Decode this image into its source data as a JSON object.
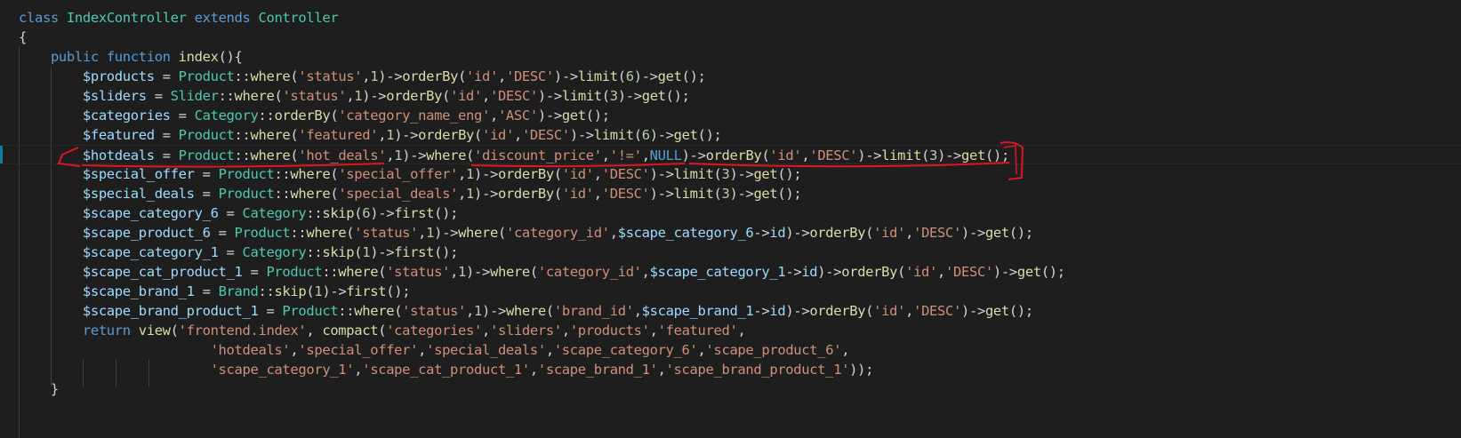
{
  "code": {
    "lines": [
      [
        [
          "kw",
          "class "
        ],
        [
          "cls",
          "IndexController "
        ],
        [
          "kw",
          "extends "
        ],
        [
          "cls",
          "Controller"
        ]
      ],
      [
        [
          "plain",
          "{"
        ]
      ],
      [
        [
          "plain",
          "    "
        ],
        [
          "kw",
          "public "
        ],
        [
          "kw",
          "function "
        ],
        [
          "fn",
          "index"
        ],
        [
          "plain",
          "(){"
        ]
      ],
      [
        [
          "plain",
          "        "
        ],
        [
          "var",
          "$products"
        ],
        [
          "plain",
          " = "
        ],
        [
          "cls",
          "Product"
        ],
        [
          "plain",
          "::"
        ],
        [
          "fn",
          "where"
        ],
        [
          "plain",
          "("
        ],
        [
          "str",
          "'status'"
        ],
        [
          "plain",
          ","
        ],
        [
          "num",
          "1"
        ],
        [
          "plain",
          ")->"
        ],
        [
          "fn",
          "orderBy"
        ],
        [
          "plain",
          "("
        ],
        [
          "str",
          "'id'"
        ],
        [
          "plain",
          ","
        ],
        [
          "str",
          "'DESC'"
        ],
        [
          "plain",
          ")->"
        ],
        [
          "fn",
          "limit"
        ],
        [
          "plain",
          "("
        ],
        [
          "num",
          "6"
        ],
        [
          "plain",
          ")->"
        ],
        [
          "fn",
          "get"
        ],
        [
          "plain",
          "();"
        ]
      ],
      [
        [
          "plain",
          "        "
        ],
        [
          "var",
          "$sliders"
        ],
        [
          "plain",
          " = "
        ],
        [
          "cls",
          "Slider"
        ],
        [
          "plain",
          "::"
        ],
        [
          "fn",
          "where"
        ],
        [
          "plain",
          "("
        ],
        [
          "str",
          "'status'"
        ],
        [
          "plain",
          ","
        ],
        [
          "num",
          "1"
        ],
        [
          "plain",
          ")->"
        ],
        [
          "fn",
          "orderBy"
        ],
        [
          "plain",
          "("
        ],
        [
          "str",
          "'id'"
        ],
        [
          "plain",
          ","
        ],
        [
          "str",
          "'DESC'"
        ],
        [
          "plain",
          ")->"
        ],
        [
          "fn",
          "limit"
        ],
        [
          "plain",
          "("
        ],
        [
          "num",
          "3"
        ],
        [
          "plain",
          ")->"
        ],
        [
          "fn",
          "get"
        ],
        [
          "plain",
          "();"
        ]
      ],
      [
        [
          "plain",
          "        "
        ],
        [
          "var",
          "$categories"
        ],
        [
          "plain",
          " = "
        ],
        [
          "cls",
          "Category"
        ],
        [
          "plain",
          "::"
        ],
        [
          "fn",
          "orderBy"
        ],
        [
          "plain",
          "("
        ],
        [
          "str",
          "'category_name_eng'"
        ],
        [
          "plain",
          ","
        ],
        [
          "str",
          "'ASC'"
        ],
        [
          "plain",
          ")->"
        ],
        [
          "fn",
          "get"
        ],
        [
          "plain",
          "();"
        ]
      ],
      [
        [
          "plain",
          "        "
        ],
        [
          "var",
          "$featured"
        ],
        [
          "plain",
          " = "
        ],
        [
          "cls",
          "Product"
        ],
        [
          "plain",
          "::"
        ],
        [
          "fn",
          "where"
        ],
        [
          "plain",
          "("
        ],
        [
          "str",
          "'featured'"
        ],
        [
          "plain",
          ","
        ],
        [
          "num",
          "1"
        ],
        [
          "plain",
          ")->"
        ],
        [
          "fn",
          "orderBy"
        ],
        [
          "plain",
          "("
        ],
        [
          "str",
          "'id'"
        ],
        [
          "plain",
          ","
        ],
        [
          "str",
          "'DESC'"
        ],
        [
          "plain",
          ")->"
        ],
        [
          "fn",
          "limit"
        ],
        [
          "plain",
          "("
        ],
        [
          "num",
          "6"
        ],
        [
          "plain",
          ")->"
        ],
        [
          "fn",
          "get"
        ],
        [
          "plain",
          "();"
        ]
      ],
      [
        [
          "plain",
          "        "
        ],
        [
          "var",
          "$hotdeals"
        ],
        [
          "plain",
          " = "
        ],
        [
          "cls",
          "Product"
        ],
        [
          "plain",
          "::"
        ],
        [
          "fn",
          "where"
        ],
        [
          "plain",
          "("
        ],
        [
          "str",
          "'hot_deals'"
        ],
        [
          "plain",
          ","
        ],
        [
          "num",
          "1"
        ],
        [
          "plain",
          ")->"
        ],
        [
          "fn",
          "where"
        ],
        [
          "plain",
          "("
        ],
        [
          "str",
          "'discount_price'"
        ],
        [
          "plain",
          ","
        ],
        [
          "str",
          "'!='"
        ],
        [
          "plain",
          ","
        ],
        [
          "kw",
          "NULL"
        ],
        [
          "plain",
          ")->"
        ],
        [
          "fn",
          "orderBy"
        ],
        [
          "plain",
          "("
        ],
        [
          "str",
          "'id'"
        ],
        [
          "plain",
          ","
        ],
        [
          "str",
          "'DESC'"
        ],
        [
          "plain",
          ")->"
        ],
        [
          "fn",
          "limit"
        ],
        [
          "plain",
          "("
        ],
        [
          "num",
          "3"
        ],
        [
          "plain",
          ")->"
        ],
        [
          "fn",
          "get"
        ],
        [
          "plain",
          "();"
        ]
      ],
      [
        [
          "plain",
          "        "
        ],
        [
          "var",
          "$special_offer"
        ],
        [
          "plain",
          " = "
        ],
        [
          "cls",
          "Product"
        ],
        [
          "plain",
          "::"
        ],
        [
          "fn",
          "where"
        ],
        [
          "plain",
          "("
        ],
        [
          "str",
          "'special_offer'"
        ],
        [
          "plain",
          ","
        ],
        [
          "num",
          "1"
        ],
        [
          "plain",
          ")->"
        ],
        [
          "fn",
          "orderBy"
        ],
        [
          "plain",
          "("
        ],
        [
          "str",
          "'id'"
        ],
        [
          "plain",
          ","
        ],
        [
          "str",
          "'DESC'"
        ],
        [
          "plain",
          ")->"
        ],
        [
          "fn",
          "limit"
        ],
        [
          "plain",
          "("
        ],
        [
          "num",
          "3"
        ],
        [
          "plain",
          ")->"
        ],
        [
          "fn",
          "get"
        ],
        [
          "plain",
          "();"
        ]
      ],
      [
        [
          "plain",
          "        "
        ],
        [
          "var",
          "$special_deals"
        ],
        [
          "plain",
          " = "
        ],
        [
          "cls",
          "Product"
        ],
        [
          "plain",
          "::"
        ],
        [
          "fn",
          "where"
        ],
        [
          "plain",
          "("
        ],
        [
          "str",
          "'special_deals'"
        ],
        [
          "plain",
          ","
        ],
        [
          "num",
          "1"
        ],
        [
          "plain",
          ")->"
        ],
        [
          "fn",
          "orderBy"
        ],
        [
          "plain",
          "("
        ],
        [
          "str",
          "'id'"
        ],
        [
          "plain",
          ","
        ],
        [
          "str",
          "'DESC'"
        ],
        [
          "plain",
          ")->"
        ],
        [
          "fn",
          "limit"
        ],
        [
          "plain",
          "("
        ],
        [
          "num",
          "3"
        ],
        [
          "plain",
          ")->"
        ],
        [
          "fn",
          "get"
        ],
        [
          "plain",
          "();"
        ]
      ],
      [
        [
          "plain",
          "        "
        ],
        [
          "var",
          "$scape_category_6"
        ],
        [
          "plain",
          " = "
        ],
        [
          "cls",
          "Category"
        ],
        [
          "plain",
          "::"
        ],
        [
          "fn",
          "skip"
        ],
        [
          "plain",
          "("
        ],
        [
          "num",
          "6"
        ],
        [
          "plain",
          ")->"
        ],
        [
          "fn",
          "first"
        ],
        [
          "plain",
          "();"
        ]
      ],
      [
        [
          "plain",
          "        "
        ],
        [
          "var",
          "$scape_product_6"
        ],
        [
          "plain",
          " = "
        ],
        [
          "cls",
          "Product"
        ],
        [
          "plain",
          "::"
        ],
        [
          "fn",
          "where"
        ],
        [
          "plain",
          "("
        ],
        [
          "str",
          "'status'"
        ],
        [
          "plain",
          ","
        ],
        [
          "num",
          "1"
        ],
        [
          "plain",
          ")->"
        ],
        [
          "fn",
          "where"
        ],
        [
          "plain",
          "("
        ],
        [
          "str",
          "'category_id'"
        ],
        [
          "plain",
          ","
        ],
        [
          "var",
          "$scape_category_6"
        ],
        [
          "plain",
          "->"
        ],
        [
          "var",
          "id"
        ],
        [
          "plain",
          ")->"
        ],
        [
          "fn",
          "orderBy"
        ],
        [
          "plain",
          "("
        ],
        [
          "str",
          "'id'"
        ],
        [
          "plain",
          ","
        ],
        [
          "str",
          "'DESC'"
        ],
        [
          "plain",
          ")->"
        ],
        [
          "fn",
          "get"
        ],
        [
          "plain",
          "();"
        ]
      ],
      [
        [
          "plain",
          "        "
        ],
        [
          "var",
          "$scape_category_1"
        ],
        [
          "plain",
          " = "
        ],
        [
          "cls",
          "Category"
        ],
        [
          "plain",
          "::"
        ],
        [
          "fn",
          "skip"
        ],
        [
          "plain",
          "("
        ],
        [
          "num",
          "1"
        ],
        [
          "plain",
          ")->"
        ],
        [
          "fn",
          "first"
        ],
        [
          "plain",
          "();"
        ]
      ],
      [
        [
          "plain",
          "        "
        ],
        [
          "var",
          "$scape_cat_product_1"
        ],
        [
          "plain",
          " = "
        ],
        [
          "cls",
          "Product"
        ],
        [
          "plain",
          "::"
        ],
        [
          "fn",
          "where"
        ],
        [
          "plain",
          "("
        ],
        [
          "str",
          "'status'"
        ],
        [
          "plain",
          ","
        ],
        [
          "num",
          "1"
        ],
        [
          "plain",
          ")->"
        ],
        [
          "fn",
          "where"
        ],
        [
          "plain",
          "("
        ],
        [
          "str",
          "'category_id'"
        ],
        [
          "plain",
          ","
        ],
        [
          "var",
          "$scape_category_1"
        ],
        [
          "plain",
          "->"
        ],
        [
          "var",
          "id"
        ],
        [
          "plain",
          ")->"
        ],
        [
          "fn",
          "orderBy"
        ],
        [
          "plain",
          "("
        ],
        [
          "str",
          "'id'"
        ],
        [
          "plain",
          ","
        ],
        [
          "str",
          "'DESC'"
        ],
        [
          "plain",
          ")->"
        ],
        [
          "fn",
          "get"
        ],
        [
          "plain",
          "();"
        ]
      ],
      [
        [
          "plain",
          "        "
        ],
        [
          "var",
          "$scape_brand_1"
        ],
        [
          "plain",
          " = "
        ],
        [
          "cls",
          "Brand"
        ],
        [
          "plain",
          "::"
        ],
        [
          "fn",
          "skip"
        ],
        [
          "plain",
          "("
        ],
        [
          "num",
          "1"
        ],
        [
          "plain",
          ")->"
        ],
        [
          "fn",
          "first"
        ],
        [
          "plain",
          "();"
        ]
      ],
      [
        [
          "plain",
          "        "
        ],
        [
          "var",
          "$scape_brand_product_1"
        ],
        [
          "plain",
          " = "
        ],
        [
          "cls",
          "Product"
        ],
        [
          "plain",
          "::"
        ],
        [
          "fn",
          "where"
        ],
        [
          "plain",
          "("
        ],
        [
          "str",
          "'status'"
        ],
        [
          "plain",
          ","
        ],
        [
          "num",
          "1"
        ],
        [
          "plain",
          ")->"
        ],
        [
          "fn",
          "where"
        ],
        [
          "plain",
          "("
        ],
        [
          "str",
          "'brand_id'"
        ],
        [
          "plain",
          ","
        ],
        [
          "var",
          "$scape_brand_1"
        ],
        [
          "plain",
          "->"
        ],
        [
          "var",
          "id"
        ],
        [
          "plain",
          ")->"
        ],
        [
          "fn",
          "orderBy"
        ],
        [
          "plain",
          "("
        ],
        [
          "str",
          "'id'"
        ],
        [
          "plain",
          ","
        ],
        [
          "str",
          "'DESC'"
        ],
        [
          "plain",
          ")->"
        ],
        [
          "fn",
          "get"
        ],
        [
          "plain",
          "();"
        ]
      ],
      [
        [
          "plain",
          "        "
        ],
        [
          "kw",
          "return "
        ],
        [
          "fn",
          "view"
        ],
        [
          "plain",
          "("
        ],
        [
          "str",
          "'frontend.index'"
        ],
        [
          "plain",
          ", "
        ],
        [
          "fn",
          "compact"
        ],
        [
          "plain",
          "("
        ],
        [
          "str",
          "'categories'"
        ],
        [
          "plain",
          ","
        ],
        [
          "str",
          "'sliders'"
        ],
        [
          "plain",
          ","
        ],
        [
          "str",
          "'products'"
        ],
        [
          "plain",
          ","
        ],
        [
          "str",
          "'featured'"
        ],
        [
          "plain",
          ","
        ]
      ],
      [
        [
          "plain",
          "                        "
        ],
        [
          "str",
          "'hotdeals'"
        ],
        [
          "plain",
          ","
        ],
        [
          "str",
          "'special_offer'"
        ],
        [
          "plain",
          ","
        ],
        [
          "str",
          "'special_deals'"
        ],
        [
          "plain",
          ","
        ],
        [
          "str",
          "'scape_category_6'"
        ],
        [
          "plain",
          ","
        ],
        [
          "str",
          "'scape_product_6'"
        ],
        [
          "plain",
          ","
        ]
      ],
      [
        [
          "plain",
          "                        "
        ],
        [
          "str",
          "'scape_category_1'"
        ],
        [
          "plain",
          ","
        ],
        [
          "str",
          "'scape_cat_product_1'"
        ],
        [
          "plain",
          ","
        ],
        [
          "str",
          "'scape_brand_1'"
        ],
        [
          "plain",
          ","
        ],
        [
          "str",
          "'scape_brand_product_1'"
        ],
        [
          "plain",
          "));"
        ]
      ],
      [
        [
          "plain",
          "    }"
        ]
      ]
    ]
  },
  "theme": {
    "background": "#1e1e1e",
    "keyword": "#569cd6",
    "class": "#4ec9b0",
    "function": "#dcdcaa",
    "variable": "#9cdcfe",
    "string": "#ce9178",
    "number": "#b5cea8",
    "annotation": "#e0161e"
  }
}
